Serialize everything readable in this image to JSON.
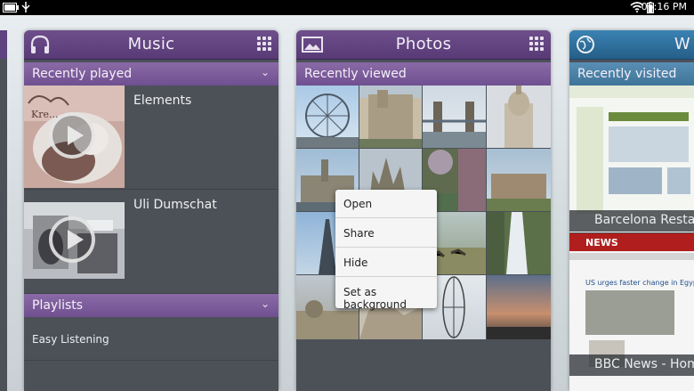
{
  "status_bar": {
    "time": "06:16 PM",
    "icons": [
      "battery-icon",
      "usb-icon",
      "wifi-icon",
      "battery-status-icon"
    ]
  },
  "music": {
    "title": "Music",
    "icon": "headphones-icon",
    "section_recent": "Recently played",
    "tracks": [
      {
        "name": "Elements"
      },
      {
        "name": "Uli Dumschat"
      }
    ],
    "section_playlists": "Playlists",
    "playlists": [
      "Easy Listening"
    ]
  },
  "photos": {
    "title": "Photos",
    "icon": "picture-icon",
    "section": "Recently viewed",
    "context_menu": [
      "Open",
      "Share",
      "Hide",
      "Set as background"
    ]
  },
  "web": {
    "title": "W",
    "icon": "globe-icon",
    "section": "Recently visited",
    "pages": [
      {
        "caption": "Barcelona Restau"
      },
      {
        "caption": "BBC News - Hom"
      }
    ]
  },
  "colors": {
    "header_purple": "#5f4280",
    "section_purple": "#7c5c9b",
    "panel_gray": "#4c5158",
    "web_header_blue": "#2d6c96"
  }
}
